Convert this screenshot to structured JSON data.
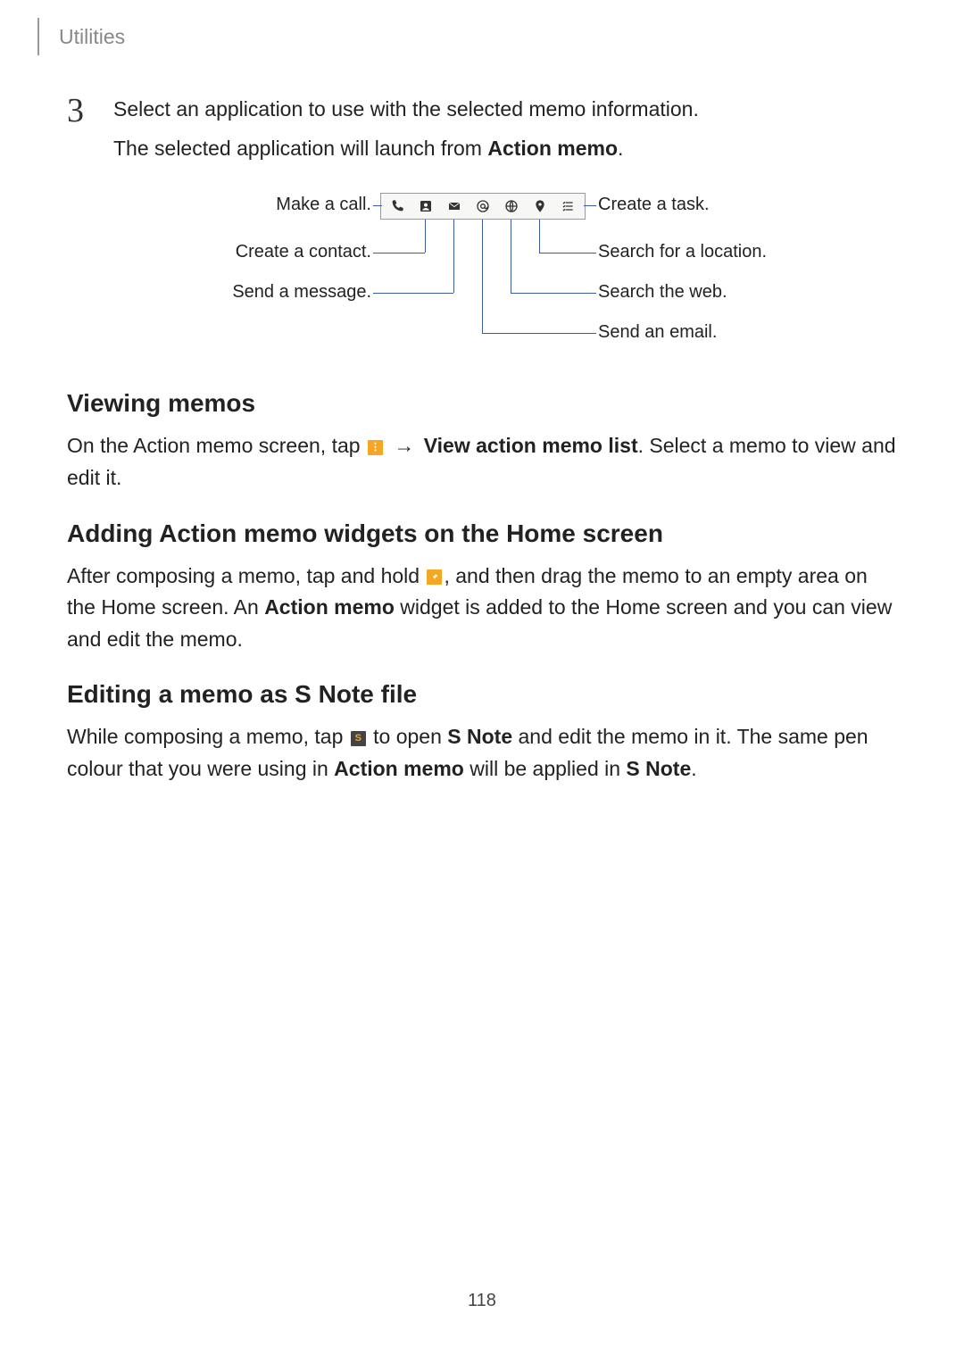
{
  "header": {
    "title": "Utilities"
  },
  "step": {
    "number": "3",
    "line1": "Select an application to use with the selected memo information.",
    "line2_pre": "The selected application will launch from ",
    "line2_bold": "Action memo",
    "line2_post": "."
  },
  "diagram": {
    "labels": {
      "call": "Make a call.",
      "contact": "Create a contact.",
      "message": "Send a message.",
      "task": "Create a task.",
      "location": "Search for a location.",
      "web": "Search the web.",
      "email": "Send an email."
    },
    "icons": {
      "phone": "phone-icon",
      "contact": "contact-icon",
      "message": "envelope-icon",
      "email": "at-icon",
      "web": "globe-icon",
      "location": "pin-icon",
      "task": "checklist-icon"
    }
  },
  "sections": {
    "viewing": {
      "title": "Viewing memos",
      "p1_pre": "On the Action memo screen, tap ",
      "p1_arrow": "→",
      "p1_bold": "View action memo list",
      "p1_post": ". Select a memo to view and edit it."
    },
    "adding": {
      "title": "Adding Action memo widgets on the Home screen",
      "p1_pre": "After composing a memo, tap and hold ",
      "p1_mid": ", and then drag the memo to an empty area on the Home screen. An ",
      "p1_bold": "Action memo",
      "p1_post": " widget is added to the Home screen and you can view and edit the memo."
    },
    "editing": {
      "title": "Editing a memo as S Note file",
      "p1_pre": "While composing a memo, tap ",
      "p1_mid1": " to open ",
      "p1_bold1": "S Note",
      "p1_mid2": " and edit the memo in it. The same pen colour that you were using in ",
      "p1_bold2": "Action memo",
      "p1_mid3": " will be applied in ",
      "p1_bold3": "S Note",
      "p1_post": "."
    }
  },
  "page_number": "118"
}
